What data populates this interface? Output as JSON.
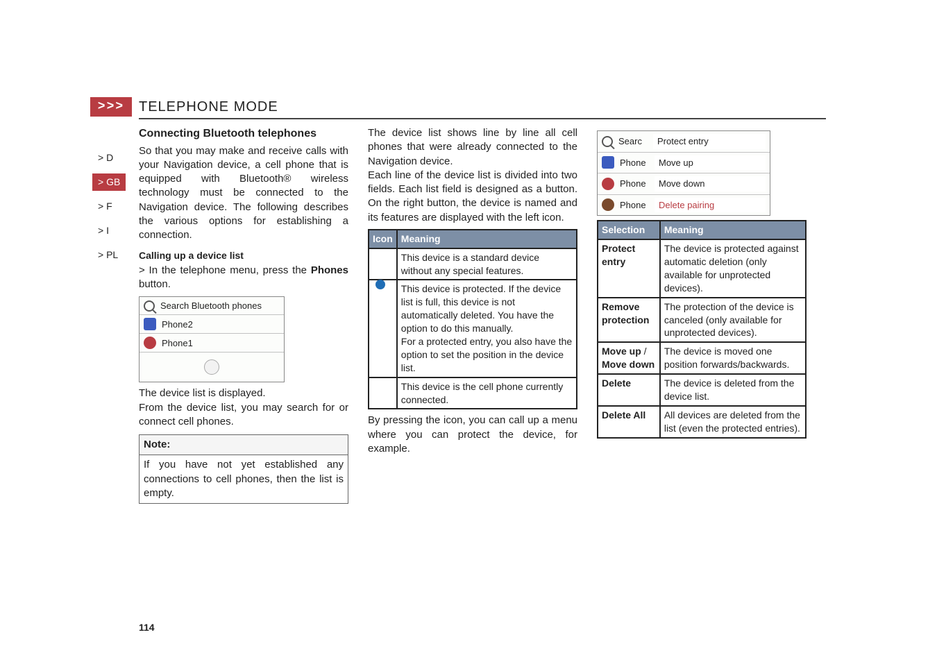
{
  "header": {
    "marker": ">>>",
    "title": "TELEPHONE MODE"
  },
  "sidenav": {
    "items": [
      {
        "label": "> D"
      },
      {
        "label": "> GB",
        "active": true
      },
      {
        "label": "> F"
      },
      {
        "label": "> I"
      },
      {
        "label": "> PL"
      }
    ]
  },
  "col1": {
    "h2": "Connecting Bluetooth telephones",
    "p1": "So that you may make and receive calls with your Navigation device, a cell phone that is equipped with Bluetooth® wireless technology must be connected to the Navigation device. The following describes the various options for establishing a connection.",
    "h3": "Calling up a device list",
    "bullet_prefix": "> In the telephone menu, press the ",
    "bullet_bold": "Phones",
    "bullet_suffix": " button.",
    "bt_list": {
      "search": "Search Bluetooth phones",
      "rows": [
        "Phone2",
        "Phone1"
      ]
    },
    "p2": "The device list is displayed.",
    "p3": "From the device list, you may search for or connect cell phones.",
    "note_head": "Note:",
    "note_body": "If you have not yet established any connections to cell phones, then the list is empty."
  },
  "col2": {
    "p1": "The device list shows line by line all cell phones that were already connected to the Navigation device.",
    "p2": "Each line of the device list is divided into two fields. Each list field is designed as a button. On the right button, the device is named and its features are displayed with the left icon.",
    "table": {
      "head": [
        "Icon",
        "Meaning"
      ],
      "rows": [
        {
          "icon": "standard",
          "text": "This device is a standard device without any special features."
        },
        {
          "icon": "shield",
          "text": "This device is protected. If the device list is full, this device is not automatically deleted. You have the option to do this manually.\nFor a protected entry, you also have the option to set the position in the device list."
        },
        {
          "icon": "blue",
          "text": "This device  is the cell phone currently connected."
        }
      ]
    },
    "p3": "By pressing the icon, you can call up a menu where you can protect the device, for example."
  },
  "col3": {
    "menu": {
      "rows": [
        {
          "left": "Searc",
          "right": "Protect entry"
        },
        {
          "left": "Phone",
          "right": "Move up"
        },
        {
          "left": "Phone",
          "right": "Move down"
        },
        {
          "left": "Phone",
          "right": "Delete pairing"
        }
      ]
    },
    "table": {
      "head": [
        "Selection",
        "Meaning"
      ],
      "rows": [
        {
          "sel": "Protect entry",
          "meaning": "The device is protected against automatic deletion (only available for unprotected devices)."
        },
        {
          "sel": "Remove protection",
          "meaning": "The protection of the device is canceled (only available for unprotected devices)."
        },
        {
          "sel": "Move up / Move down",
          "sel_line1": "Move up",
          "sel_sep": " / ",
          "sel_line2": "Move down",
          "meaning": "The device is moved one position forwards/backwards."
        },
        {
          "sel": "Delete",
          "meaning": "The device is deleted from the device list."
        },
        {
          "sel": "Delete All",
          "meaning": "All devices are deleted from the list (even the protected entries)."
        }
      ]
    }
  },
  "page_number": "114"
}
